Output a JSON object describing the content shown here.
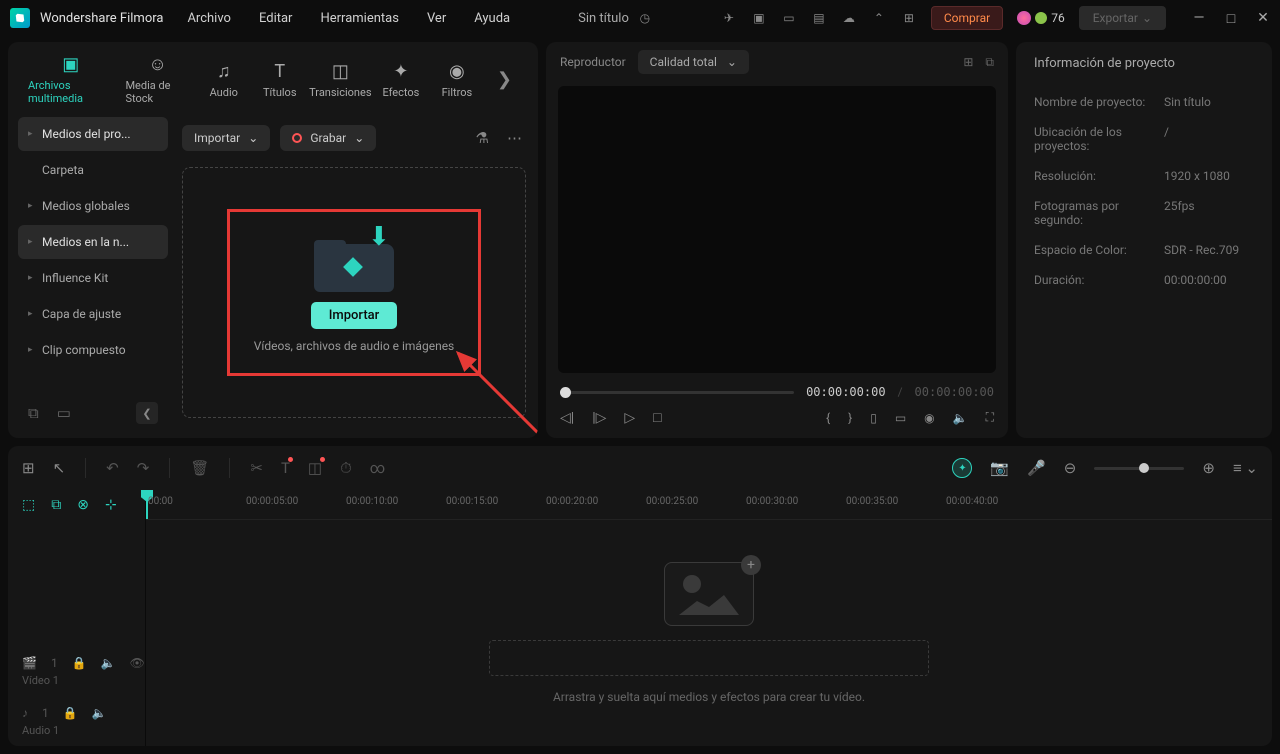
{
  "app_name": "Wondershare Filmora",
  "menu": [
    "Archivo",
    "Editar",
    "Herramientas",
    "Ver",
    "Ayuda"
  ],
  "doc_title": "Sin título",
  "buy_label": "Comprar",
  "credits_value": "76",
  "export_label": "Exportar",
  "tabs": [
    {
      "label": "Archivos multimedia"
    },
    {
      "label": "Media de Stock"
    },
    {
      "label": "Audio"
    },
    {
      "label": "Títulos"
    },
    {
      "label": "Transiciones"
    },
    {
      "label": "Efectos"
    },
    {
      "label": "Filtros"
    }
  ],
  "sidebar": {
    "items": [
      {
        "label": "Medios del pro..."
      },
      {
        "label": "Carpeta"
      },
      {
        "label": "Medios globales"
      },
      {
        "label": "Medios en la n..."
      },
      {
        "label": "Influence Kit"
      },
      {
        "label": "Capa de ajuste"
      },
      {
        "label": "Clip compuesto"
      }
    ]
  },
  "import_btn_label": "Importar",
  "record_btn_label": "Grabar",
  "dropzone": {
    "button": "Importar",
    "hint": "Vídeos, archivos de audio e imágenes"
  },
  "preview": {
    "title": "Reproductor",
    "quality": "Calidad total",
    "current_time": "00:00:00:00",
    "total_time": "00:00:00:00"
  },
  "info": {
    "title": "Información de proyecto",
    "rows": [
      {
        "label": "Nombre de proyecto:",
        "value": "Sin título"
      },
      {
        "label": "Ubicación de los proyectos:",
        "value": "/"
      },
      {
        "label": "Resolución:",
        "value": "1920 x 1080"
      },
      {
        "label": "Fotogramas por segundo:",
        "value": "25fps"
      },
      {
        "label": "Espacio de Color:",
        "value": "SDR - Rec.709"
      },
      {
        "label": "Duración:",
        "value": "00:00:00:00"
      }
    ]
  },
  "timeline": {
    "ruler": [
      "00:00",
      "00:00:05:00",
      "00:00:10:00",
      "00:00:15:00",
      "00:00:20:00",
      "00:00:25:00",
      "00:00:30:00",
      "00:00:35:00",
      "00:00:40:00"
    ],
    "tracks": {
      "video": "Vídeo 1",
      "audio": "Audio 1"
    },
    "drop_hint": "Arrastra y suelta aquí medios y efectos para crear tu vídeo."
  }
}
